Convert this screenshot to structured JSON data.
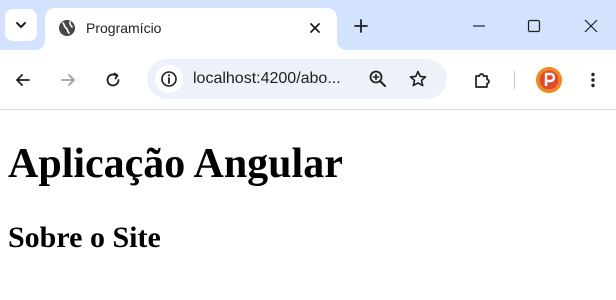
{
  "browser": {
    "tab": {
      "title": "Programício",
      "favicon": "globe-icon"
    },
    "address_bar": {
      "url": "localhost:4200/abo...",
      "site_info_icon": "info-icon"
    },
    "icons": {
      "tab_search": "chevron-down-icon",
      "tab_close": "close-icon",
      "new_tab": "plus-icon",
      "minimize": "minimize-icon",
      "maximize": "maximize-icon",
      "close_window": "close-icon",
      "back": "arrow-left-icon",
      "forward": "arrow-right-icon",
      "reload": "reload-icon",
      "zoom": "zoom-in-icon",
      "bookmark": "star-icon",
      "extensions": "puzzle-icon",
      "profile": "profile-avatar",
      "menu": "more-vertical-icon"
    },
    "colors": {
      "tabstrip": "#d3e3fd",
      "omnibox": "#edf2fa",
      "profile_accent": "#f08a24"
    }
  },
  "page": {
    "heading": "Aplicação Angular",
    "subheading": "Sobre o Site"
  }
}
